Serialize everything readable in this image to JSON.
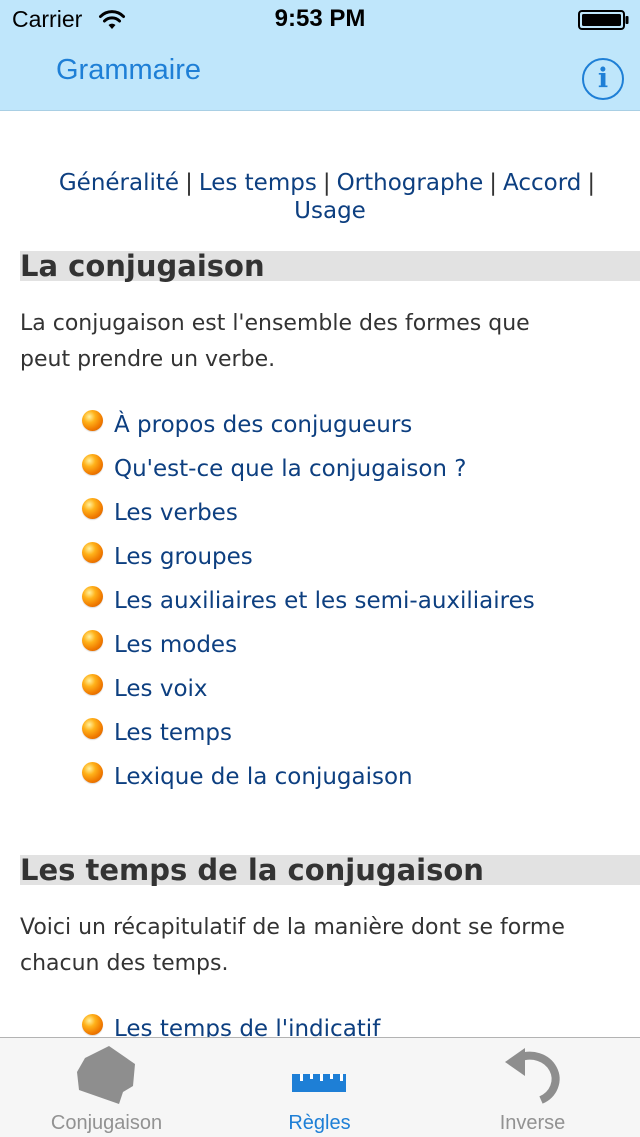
{
  "status_bar": {
    "carrier": "Carrier",
    "time": "9:53 PM"
  },
  "nav": {
    "title": "Grammaire",
    "info_icon": "info-icon"
  },
  "top_links": {
    "items": [
      "Généralité",
      "Les temps",
      "Orthographe",
      "Accord",
      "Usage"
    ],
    "separator": "|"
  },
  "sections": [
    {
      "heading": "La conjugaison",
      "paragraph_line1": "La conjugaison est l'ensemble des formes que",
      "paragraph_line2": "peut prendre un verbe.",
      "links": [
        "À propos des conjugueurs",
        "Qu'est-ce que la conjugaison ?",
        "Les verbes",
        "Les groupes",
        "Les auxiliaires et les semi-auxiliaires",
        "Les modes",
        "Les voix",
        "Les temps",
        "Lexique de la conjugaison"
      ]
    },
    {
      "heading": "Les temps de la conjugaison",
      "paragraph_line1": "Voici un récapitulatif de la manière dont se forme",
      "paragraph_line2": "chacun des temps.",
      "links": [
        "Les temps de l'indicatif"
      ]
    }
  ],
  "tab_bar": {
    "tabs": [
      {
        "label": "Conjugaison",
        "icon": "book-icon",
        "active": false
      },
      {
        "label": "Règles",
        "icon": "ruler-icon",
        "active": true
      },
      {
        "label": "Inverse",
        "icon": "undo-arrow-icon",
        "active": false
      }
    ]
  },
  "colors": {
    "header_background": "#bfe6fb",
    "accent_blue": "#1e7fd6",
    "link_blue": "#0d3f80",
    "heading_background": "#e2e2e2",
    "bullet_orange": "#f07a00",
    "tab_inactive": "#929292"
  }
}
